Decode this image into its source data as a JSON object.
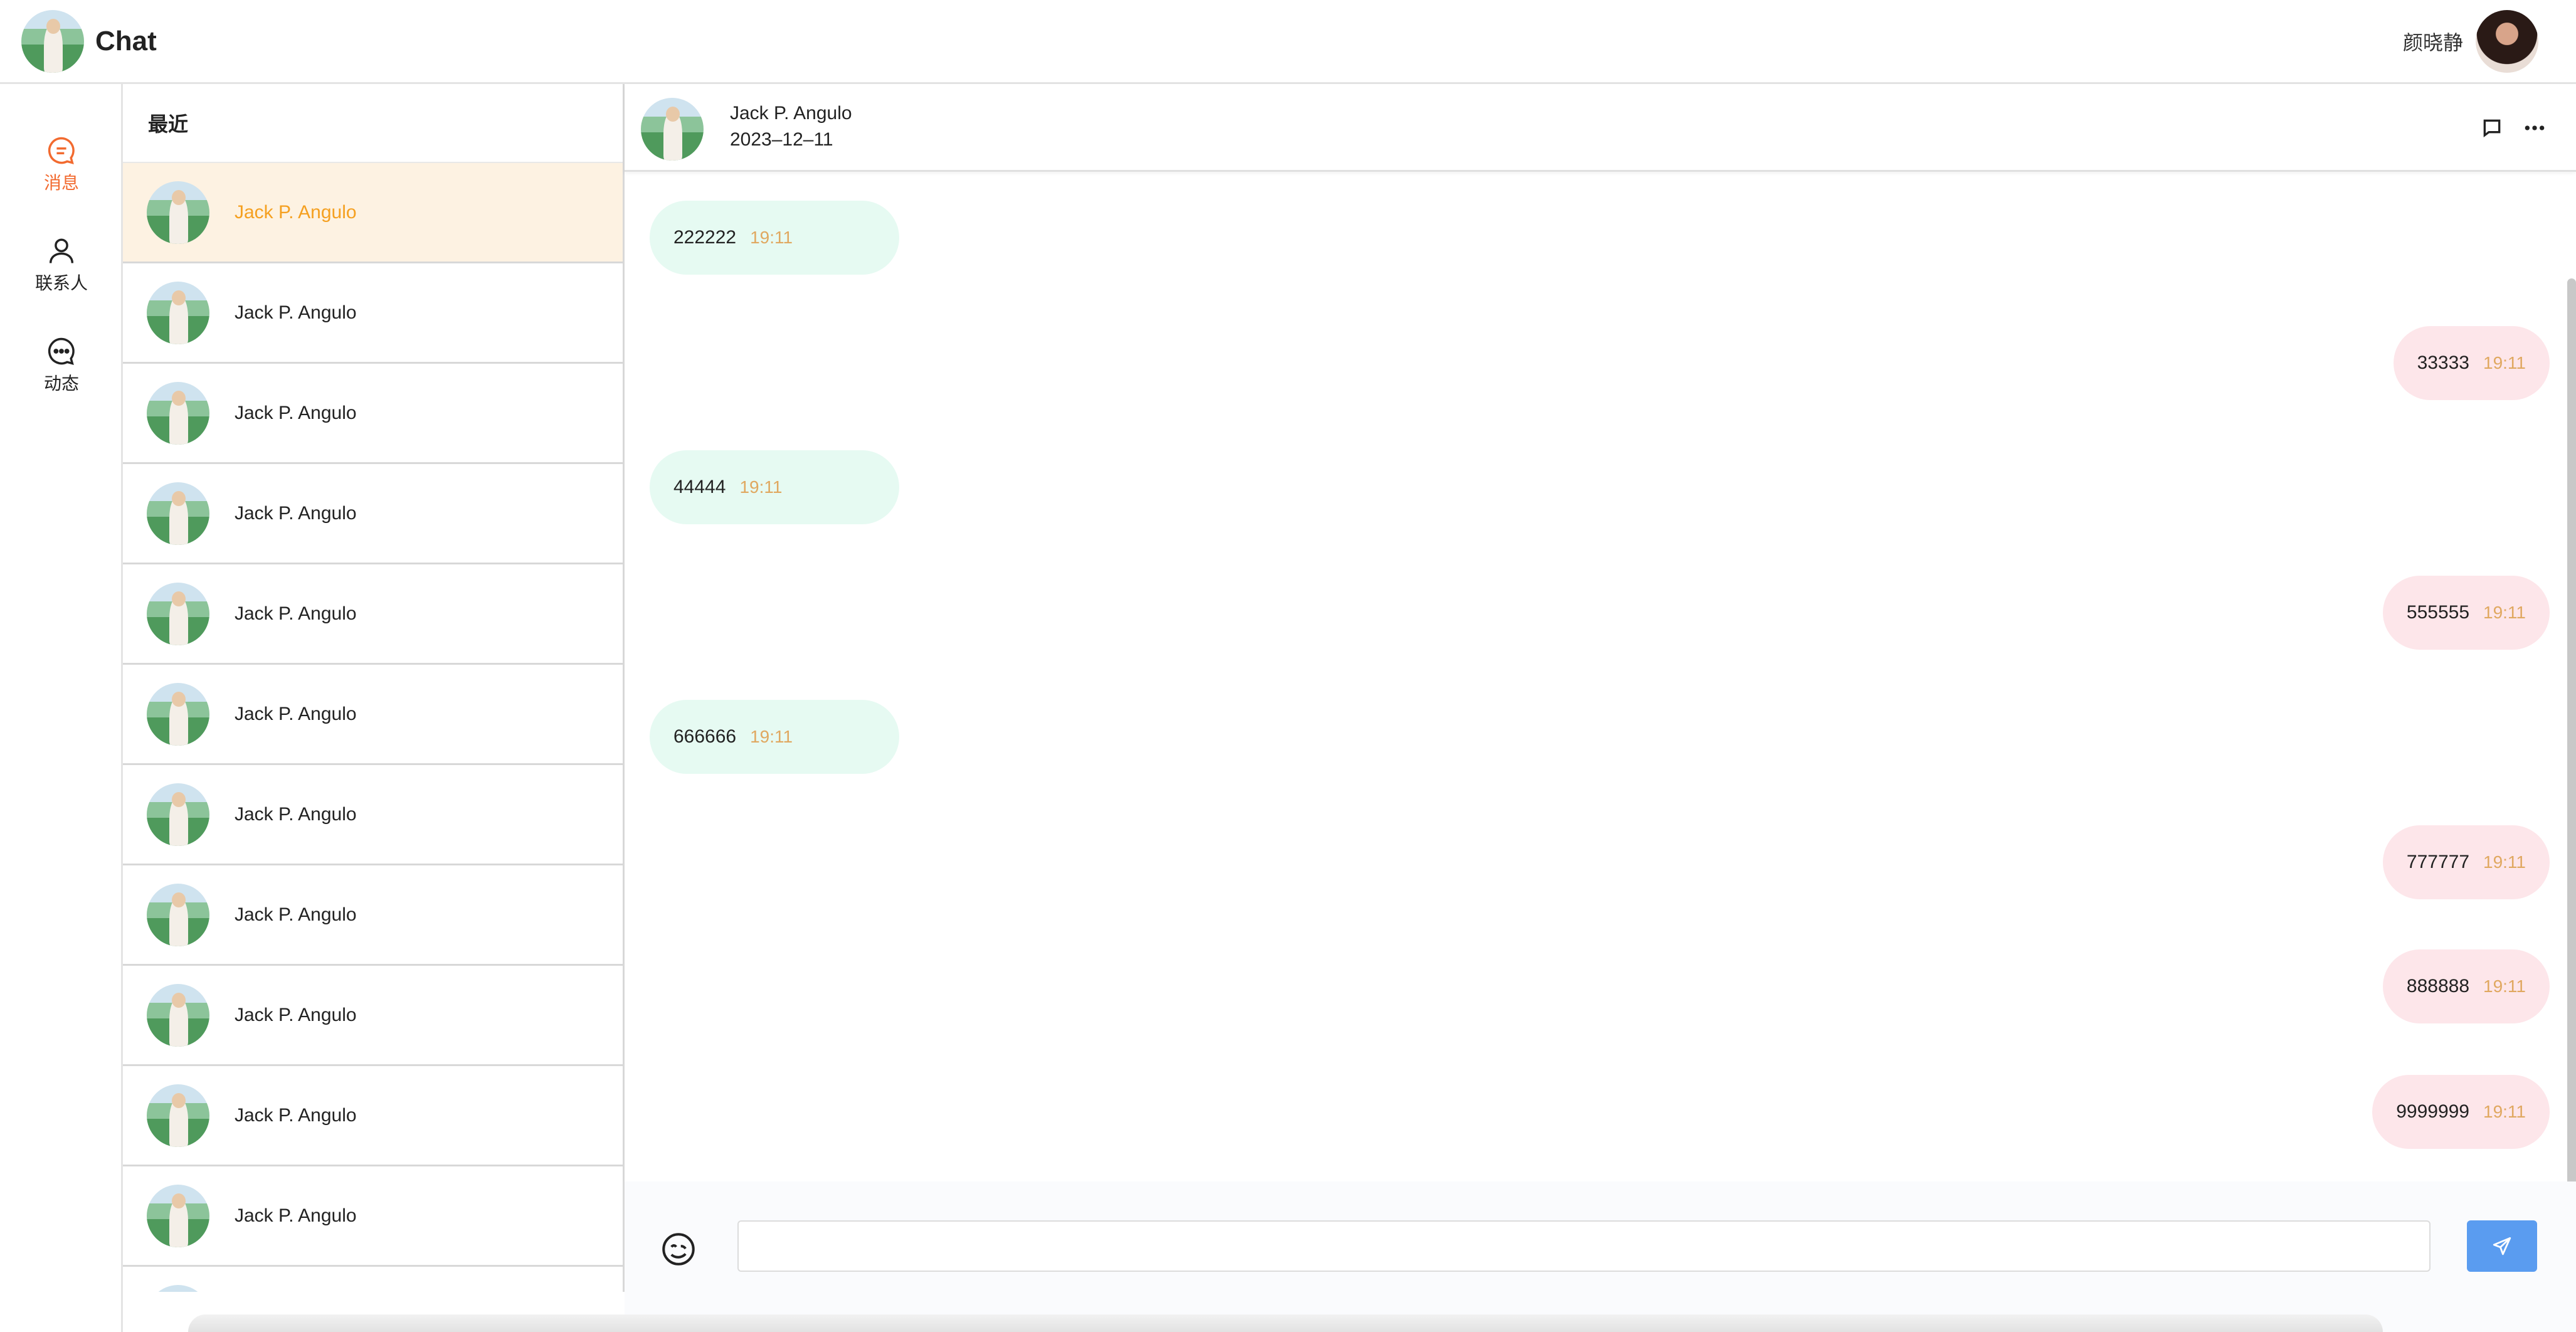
{
  "app": {
    "title": "Chat"
  },
  "user": {
    "name": "颜晓静"
  },
  "rail": {
    "items": [
      {
        "label": "消息",
        "icon": "message-icon",
        "active": true
      },
      {
        "label": "联系人",
        "icon": "contact-icon",
        "active": false
      },
      {
        "label": "动态",
        "icon": "moments-icon",
        "active": false
      }
    ]
  },
  "list": {
    "header": "最近",
    "items": [
      {
        "name": "Jack P. Angulo"
      },
      {
        "name": "Jack P. Angulo"
      },
      {
        "name": "Jack P. Angulo"
      },
      {
        "name": "Jack P. Angulo"
      },
      {
        "name": "Jack P. Angulo"
      },
      {
        "name": "Jack P. Angulo"
      },
      {
        "name": "Jack P. Angulo"
      },
      {
        "name": "Jack P. Angulo"
      },
      {
        "name": "Jack P. Angulo"
      },
      {
        "name": "Jack P. Angulo"
      },
      {
        "name": "Jack P. Angulo"
      }
    ]
  },
  "chat": {
    "peer_name": "Jack P. Angulo",
    "date": "2023–12–11",
    "messages": [
      {
        "text": "222222",
        "time": "19:11",
        "direction": "in"
      },
      {
        "text": "33333",
        "time": "19:11",
        "direction": "out"
      },
      {
        "text": "44444",
        "time": "19:11",
        "direction": "in"
      },
      {
        "text": "555555",
        "time": "19:11",
        "direction": "out"
      },
      {
        "text": "666666",
        "time": "19:11",
        "direction": "in"
      },
      {
        "text": "777777",
        "time": "19:11",
        "direction": "out"
      },
      {
        "text": "888888",
        "time": "19:11",
        "direction": "out"
      },
      {
        "text": "9999999",
        "time": "19:11",
        "direction": "out"
      }
    ]
  },
  "composer": {
    "input_value": "",
    "placeholder": ""
  },
  "colors": {
    "accent": "#f26a2f",
    "active_name": "#f5a020",
    "active_row_bg": "#fdf2e2",
    "incoming_bubble": "#e6faf2",
    "outgoing_bubble": "#fde6ea",
    "time_text": "#e0a860",
    "send_button": "#5a9cf0"
  }
}
